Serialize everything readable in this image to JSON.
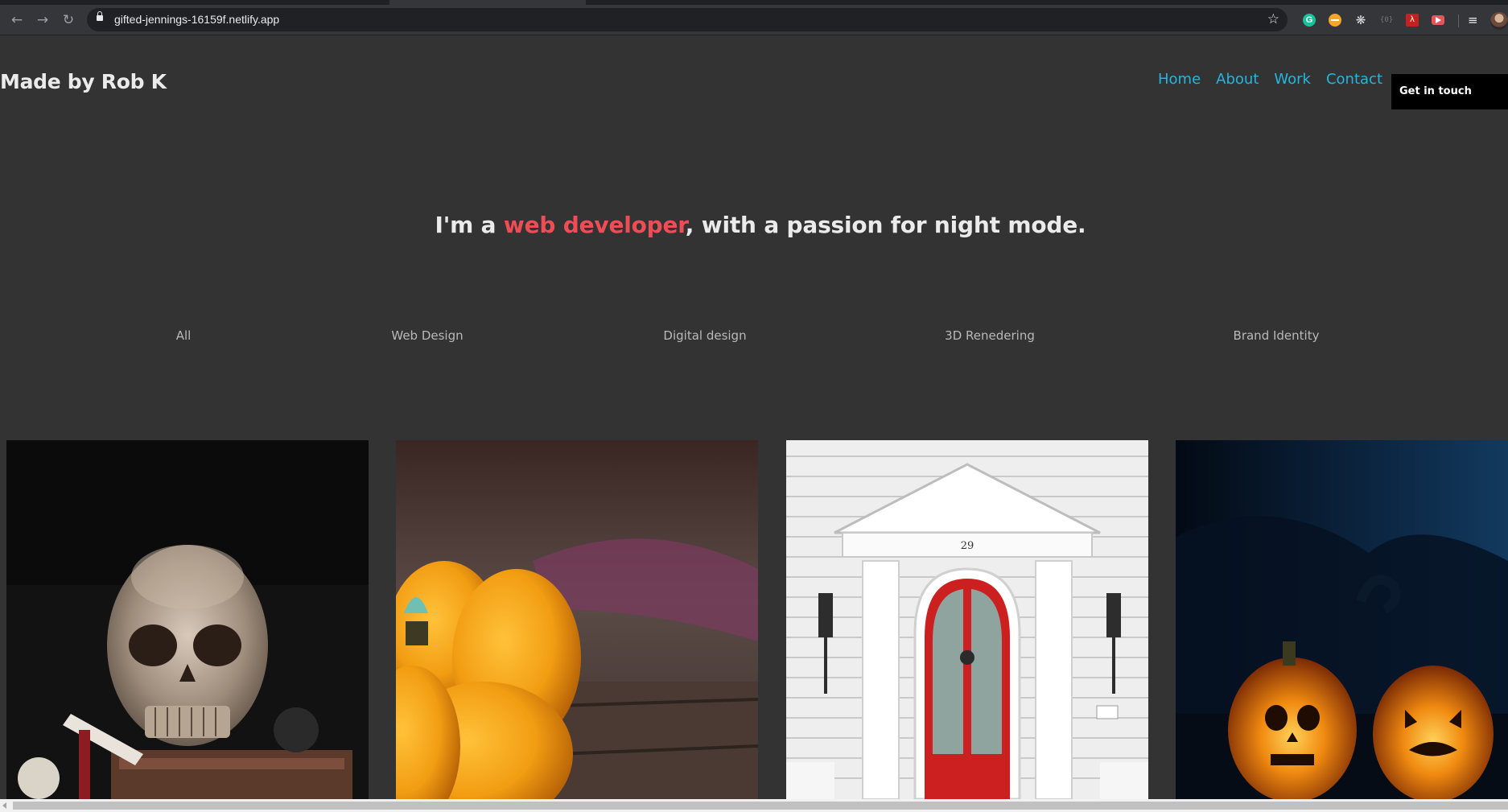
{
  "browser": {
    "url": "gifted-jennings-16159f.netlify.app",
    "back_icon": "arrow-left-icon",
    "forward_icon": "arrow-right-icon",
    "reload_icon": "reload-icon",
    "star_icon": "star-icon",
    "extensions": [
      "grammarly-icon",
      "minus-badge-icon",
      "react-devtools-icon",
      "tag-icon",
      "acrobat-icon",
      "recorder-icon"
    ],
    "extension_g_letter": "G",
    "reading_list_icon": "reading-list-icon"
  },
  "header": {
    "brand": "Made by Rob K",
    "nav": [
      "Home",
      "About",
      "Work",
      "Contact"
    ],
    "cta": "Get in touch",
    "accent_color": "#22b6e0"
  },
  "hero": {
    "before": "I'm a ",
    "highlight": "web developer",
    "after": ", with a passion for night mode.",
    "highlight_color": "#ef4d56"
  },
  "filters": [
    "All",
    "Web Design",
    "Digital design",
    "3D Renedering",
    "Brand Identity"
  ],
  "gallery": [
    {
      "subject": "sugar skull on books"
    },
    {
      "subject": "orange pumpkin close-up"
    },
    {
      "subject": "white house with red door"
    },
    {
      "subject": "carved jack-o-lanterns at night"
    }
  ],
  "door_number": "29"
}
